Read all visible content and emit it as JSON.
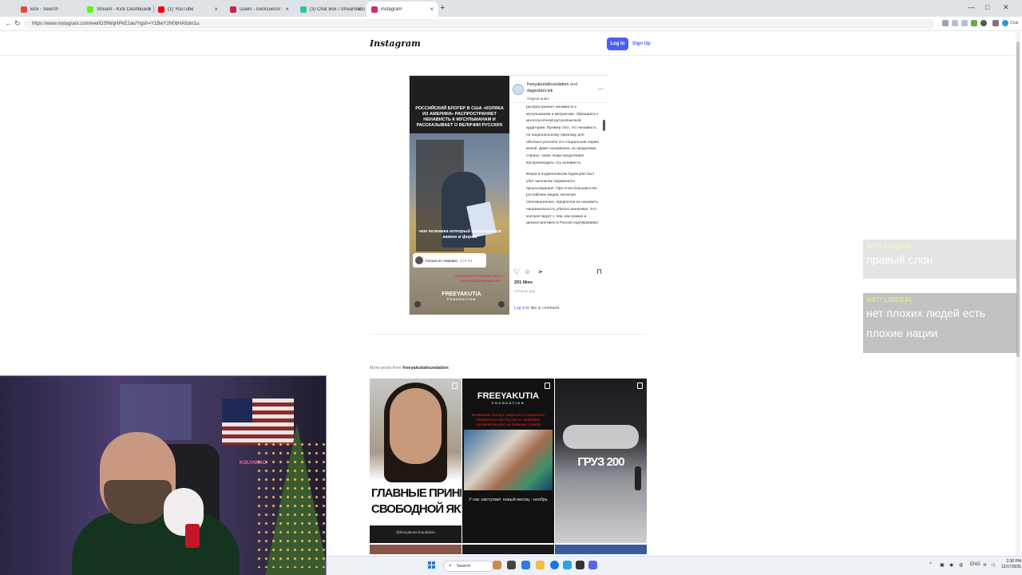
{
  "browser": {
    "tabs": [
      {
        "title": "kick - Search",
        "color": "#e04b3c"
      },
      {
        "title": "Stream - Kick Dashboard",
        "color": "#53fc18"
      },
      {
        "title": "(1) YouTube",
        "color": "#ff0000"
      },
      {
        "title": "Duels - GeoGuessr",
        "color": "#c8264b"
      },
      {
        "title": "(3) Chat Box / Streamlabs",
        "color": "#31c3a2"
      },
      {
        "title": "instagram",
        "color": "#d62976"
      }
    ],
    "new_tab_label": "+",
    "url": "https://www.instagram.com/reel/DSfWqHPkE2ao/?igsh=Y1BwY2N0bHA5dm1u",
    "profile_label": "Chat"
  },
  "instagram": {
    "logo": "Instagram",
    "login_label": "Log In",
    "signup_label": "Sign Up",
    "post": {
      "headline": "РОССИЙСКИЙ БЛОГЕР В США «КОЛЯКА ИЗ АМЕРИКИ» РАСПРОСТРАНЯЕТ НЕНАВИСТЬ К МУСУЛЬМАНАМ И РАССКАЗЫВАЕТ О ВЕЛИЧИИ РУССКИХ",
      "caption": "чем человека который поклоняется камню в форме",
      "card_name": "Колька из Америки",
      "card_time": "4:18 пм",
      "warning": "Осторожно! В ролике есть и пропаганда ненависти",
      "media_logo": "FREEYAKUTIA",
      "media_logo_sub": "FOUNDATION",
      "author_line1": "freeyakutiafoundation",
      "author_and": "and",
      "author_line2": "dagestani.lek",
      "audio": "Original audio",
      "more_label": "···",
      "text_p1": "распространяет ненависть к мусульманам и мигрантам, обращаясь к многотысячной русскоязычной аудитории. Пример того, что ненависть по национальному признаку для обычных россиян это социальная норма жизни. Даже оказавшись за пределами страны, такие люди продолжают воспроизводить эту ненависть.",
      "text_p2": "Вчера в подмосковном Одинцово был убит школьник таджикского происхождения. При этом большинство российских медиа, включая оппозиционные, предпочли не называть национальность убитого мальчика. Это контрастирует с тем, как громко и демонстративно в России подчёркивают",
      "likes": "201 likes",
      "time_ago": "12 hours ago",
      "login_link": "Log in",
      "comment_suffix": " to like or comment."
    },
    "more_posts_prefix": "More posts from ",
    "more_posts_account": "freeyakutiafoundation",
    "grid": [
      {
        "title": "ГЛАВНЫЕ ПРИНЦИПЫ СВОБОДНОЙ ЯКУТИИ",
        "line1": "ГЛАВНЫЕ ПРИНЦИП",
        "line2": "СВОБОДНОЙ ЯКУТ",
        "footer": "@freeyakutia.foundation"
      },
      {
        "logo": "FREEYAKUTIA",
        "logo_sub": "FOUNDATION",
        "red": "Внимание! Запись закрытого совещания Правительства Якутии по вербовке «добровольцев» на военную службу",
        "sub": "У нас наступает новый месяц - ноябрь"
      },
      {
        "title": "ГРУЗ 200"
      }
    ]
  },
  "chat": [
    {
      "user": "ANTI LIBERAL",
      "message": "правый слон",
      "faded": true
    },
    {
      "user": "ANTI LIBERAL",
      "message": "нет плохих людей есть плохие нации",
      "faded": false
    }
  ],
  "webcam": {
    "neon_sign": "KOLYAKNO"
  },
  "taskbar": {
    "search_placeholder": "Search",
    "lang": "ENG",
    "time": "2:30 PM",
    "date": "12/17/2025"
  },
  "colors": {
    "ig_blue": "#4a5df9",
    "chat_user": "#d7f27a",
    "warning_red": "#e21f3d"
  }
}
